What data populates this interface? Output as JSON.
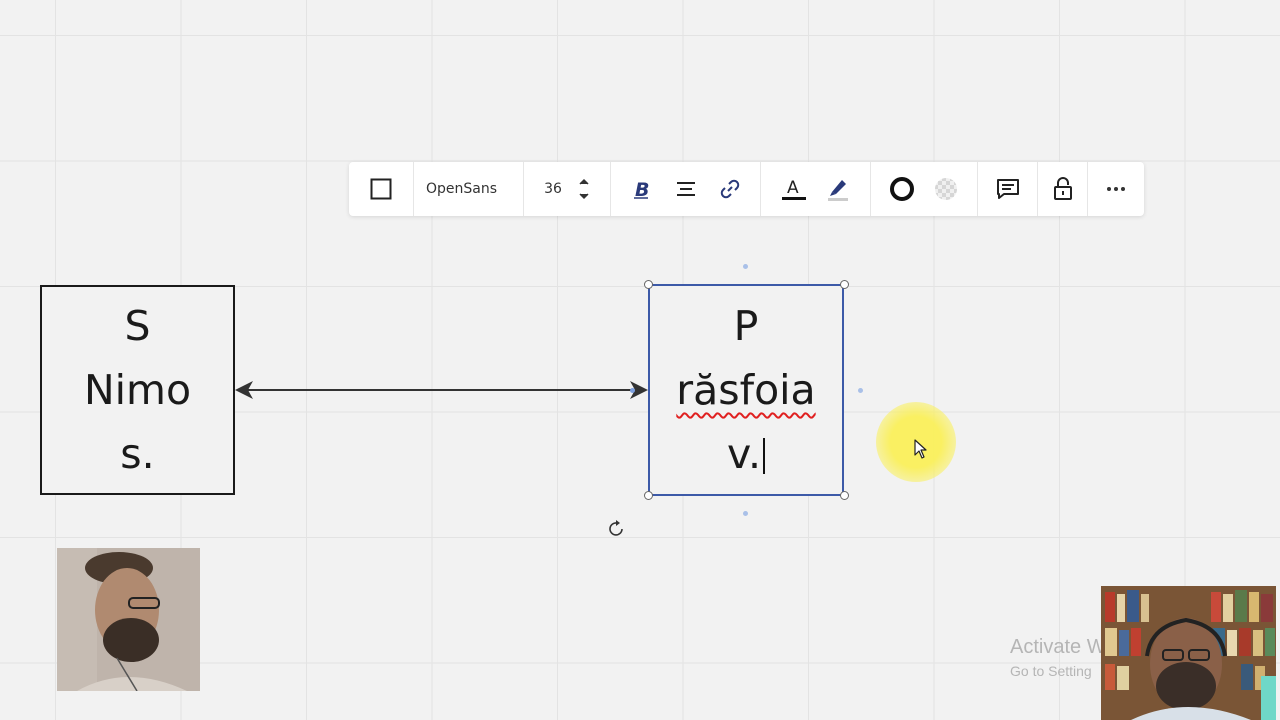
{
  "toolbar": {
    "font_name": "OpenSans",
    "font_size": "36",
    "items": [
      {
        "name": "shape-square",
        "icon": "square-outline-icon"
      },
      {
        "name": "font-select",
        "icon": ""
      },
      {
        "name": "font-size",
        "icon": "stepper-icon"
      },
      {
        "name": "bold",
        "icon": "bold-icon"
      },
      {
        "name": "align",
        "icon": "align-center-icon"
      },
      {
        "name": "link",
        "icon": "link-icon"
      },
      {
        "name": "text-color",
        "icon": "text-color-icon"
      },
      {
        "name": "highlight",
        "icon": "highlighter-icon"
      },
      {
        "name": "border-style",
        "icon": "circle-outline-icon"
      },
      {
        "name": "fill",
        "icon": "transparent-fill-icon"
      },
      {
        "name": "comment",
        "icon": "comment-icon"
      },
      {
        "name": "lock",
        "icon": "unlock-icon"
      },
      {
        "name": "more",
        "icon": "ellipsis-icon"
      }
    ]
  },
  "left_box": {
    "lines": [
      "S",
      "Nimo",
      "s."
    ]
  },
  "right_box": {
    "line1": "P",
    "line2": "răsfoia",
    "line3": "v."
  },
  "watermark": {
    "title": "Activate W",
    "subtitle": "Go to Setting"
  },
  "colors": {
    "selection": "#3d5aa8",
    "spellcheck": "#e02020",
    "canvas": "#f2f2f2",
    "cursor_highlight": "#f5eb5a"
  }
}
